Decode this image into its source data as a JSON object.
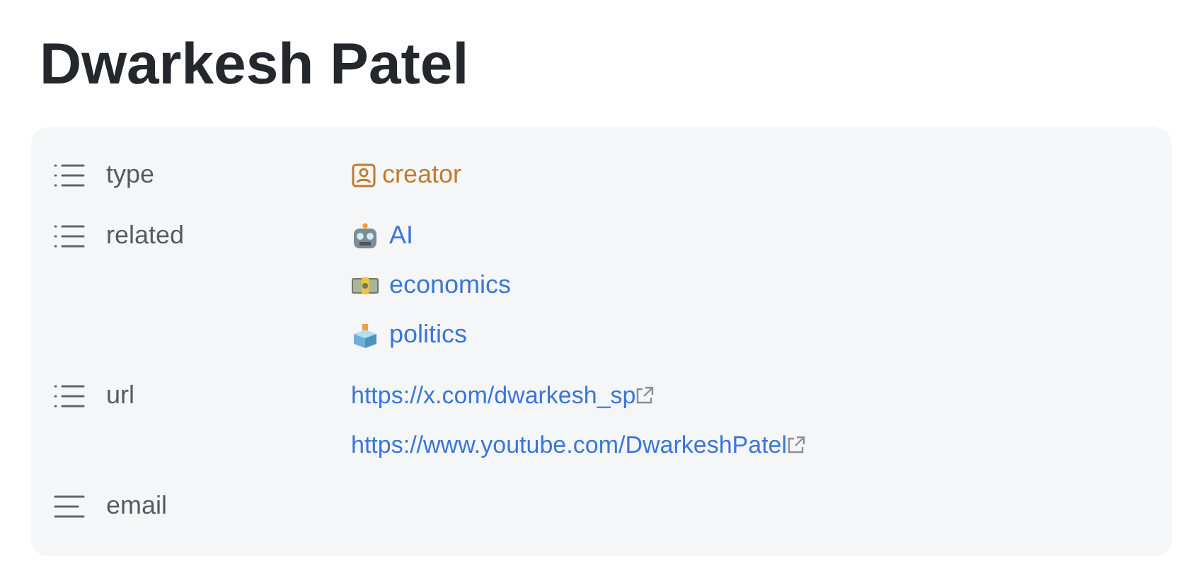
{
  "title": "Dwarkesh Patel",
  "properties": [
    {
      "name": "type",
      "kind": "list",
      "values": [
        {
          "kind": "tag",
          "text": "creator"
        }
      ]
    },
    {
      "name": "related",
      "kind": "list",
      "values": [
        {
          "kind": "link",
          "text": "AI"
        },
        {
          "kind": "link",
          "text": "economics"
        },
        {
          "kind": "link",
          "text": "politics"
        }
      ]
    },
    {
      "name": "url",
      "kind": "list",
      "values": [
        {
          "kind": "url",
          "text": "https://x.com/dwarkesh_sp"
        },
        {
          "kind": "url",
          "text": "https://www.youtube.com/DwarkeshPatel"
        }
      ]
    },
    {
      "name": "email",
      "kind": "text"
    }
  ]
}
